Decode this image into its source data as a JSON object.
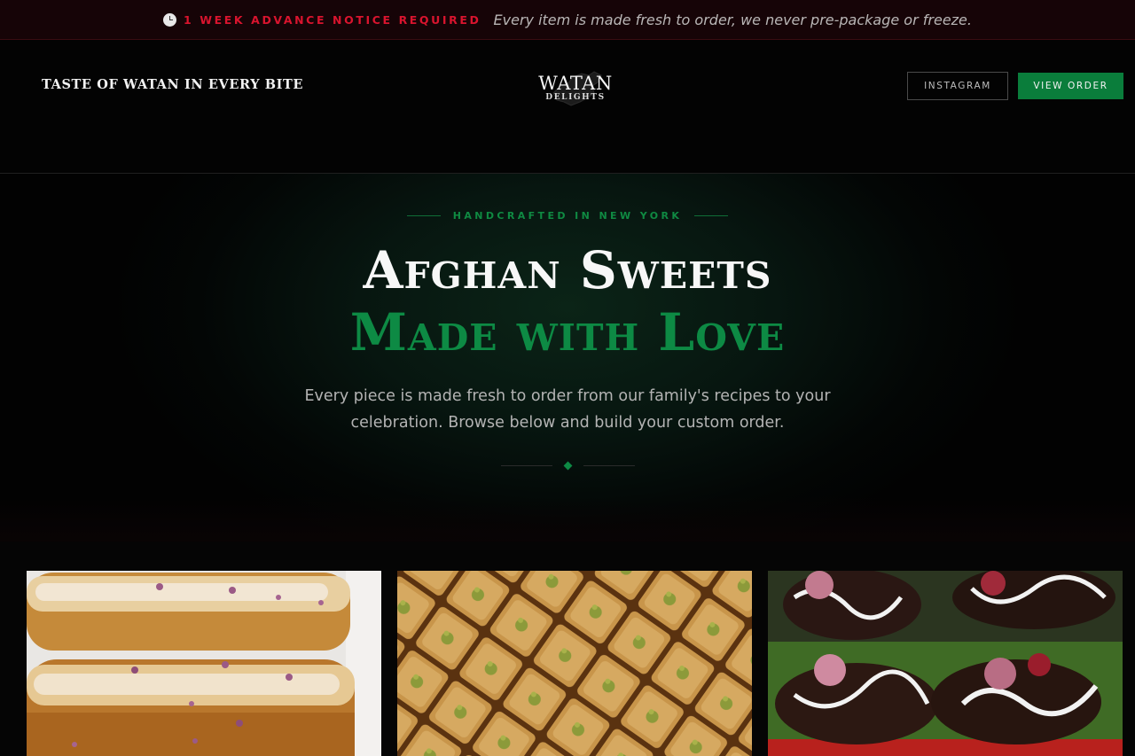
{
  "notice": {
    "icon": "clock-icon",
    "strong": "1 WEEK ADVANCE NOTICE REQUIRED",
    "text": "Every item is made fresh to order, we never pre-package or freeze."
  },
  "header": {
    "tagline": "TASTE OF WATAN IN EVERY BITE",
    "logo": {
      "word": "WATAN",
      "sub": "DELIGHTS"
    },
    "instagram_label": "INSTAGRAM",
    "order_label": "VIEW ORDER"
  },
  "hero": {
    "eyebrow": "HANDCRAFTED IN NEW YORK",
    "title": "Afghan Sweets",
    "title_accent": "Made with Love",
    "description": "Every piece is made fresh to order from our family's recipes to your celebration. Browse below and build your custom order."
  },
  "products": [
    {
      "image": "cream-roll-pastries-photo"
    },
    {
      "image": "baklava-photo"
    },
    {
      "image": "chocolate-dates-photo"
    }
  ],
  "colors": {
    "accent_green": "#0d8a44",
    "notice_red": "#d9142e",
    "background": "#030303"
  }
}
